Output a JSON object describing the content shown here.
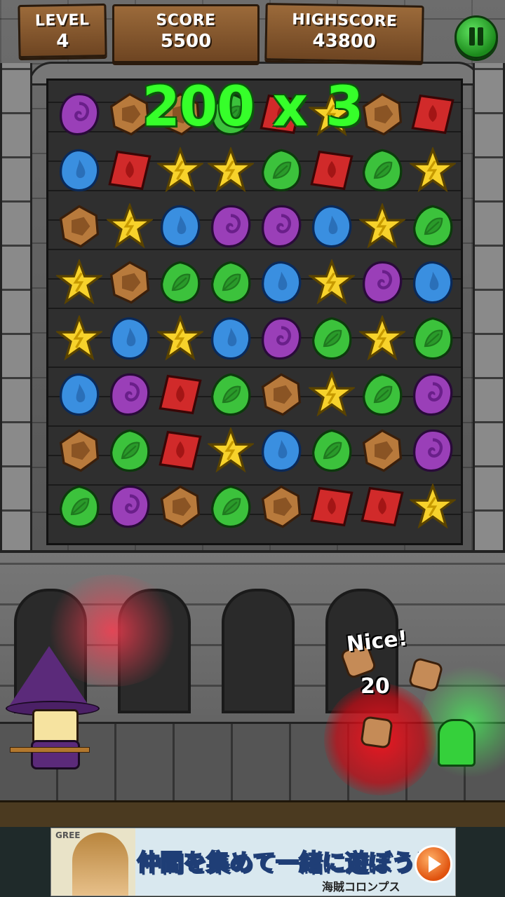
{
  "hud": {
    "level_label": "LEVEL",
    "level_value": "4",
    "score_label": "SCORE",
    "score_value": "5500",
    "highscore_label": "HIGHSCORE",
    "highscore_value": "43800"
  },
  "combo_text": "200 x 3",
  "battle": {
    "praise_text": "Nice!",
    "damage_text": "20"
  },
  "ad": {
    "network_label": "GREE",
    "headline": "仲間を集めて一緒に遊ぼう！",
    "game_title": "海賊コロンプス"
  },
  "gem_types": {
    "P": "purple-spiral",
    "O": "brown-rock",
    "R": "red-fire",
    "Y": "yellow-lightning-star",
    "G": "green-leaf",
    "B": "blue-water"
  },
  "board": [
    [
      "P",
      "O",
      "O",
      "G",
      "R",
      "Y",
      "O",
      "R"
    ],
    [
      "B",
      "R",
      "Y",
      "Y",
      "G",
      "R",
      "G",
      "Y"
    ],
    [
      "O",
      "Y",
      "B",
      "P",
      "P",
      "B",
      "Y",
      "G"
    ],
    [
      "Y",
      "O",
      "G",
      "G",
      "B",
      "Y",
      "P",
      "B"
    ],
    [
      "Y",
      "B",
      "Y",
      "B",
      "P",
      "G",
      "Y",
      "G"
    ],
    [
      "B",
      "P",
      "R",
      "G",
      "O",
      "Y",
      "G",
      "P"
    ],
    [
      "O",
      "G",
      "R",
      "Y",
      "B",
      "G",
      "O",
      "P"
    ],
    [
      "G",
      "P",
      "O",
      "G",
      "O",
      "R",
      "R",
      "Y"
    ]
  ],
  "colors": {
    "combo_green": "#36ff2a",
    "pause_green": "#2fb82f",
    "wood": "#8a5a2e"
  }
}
